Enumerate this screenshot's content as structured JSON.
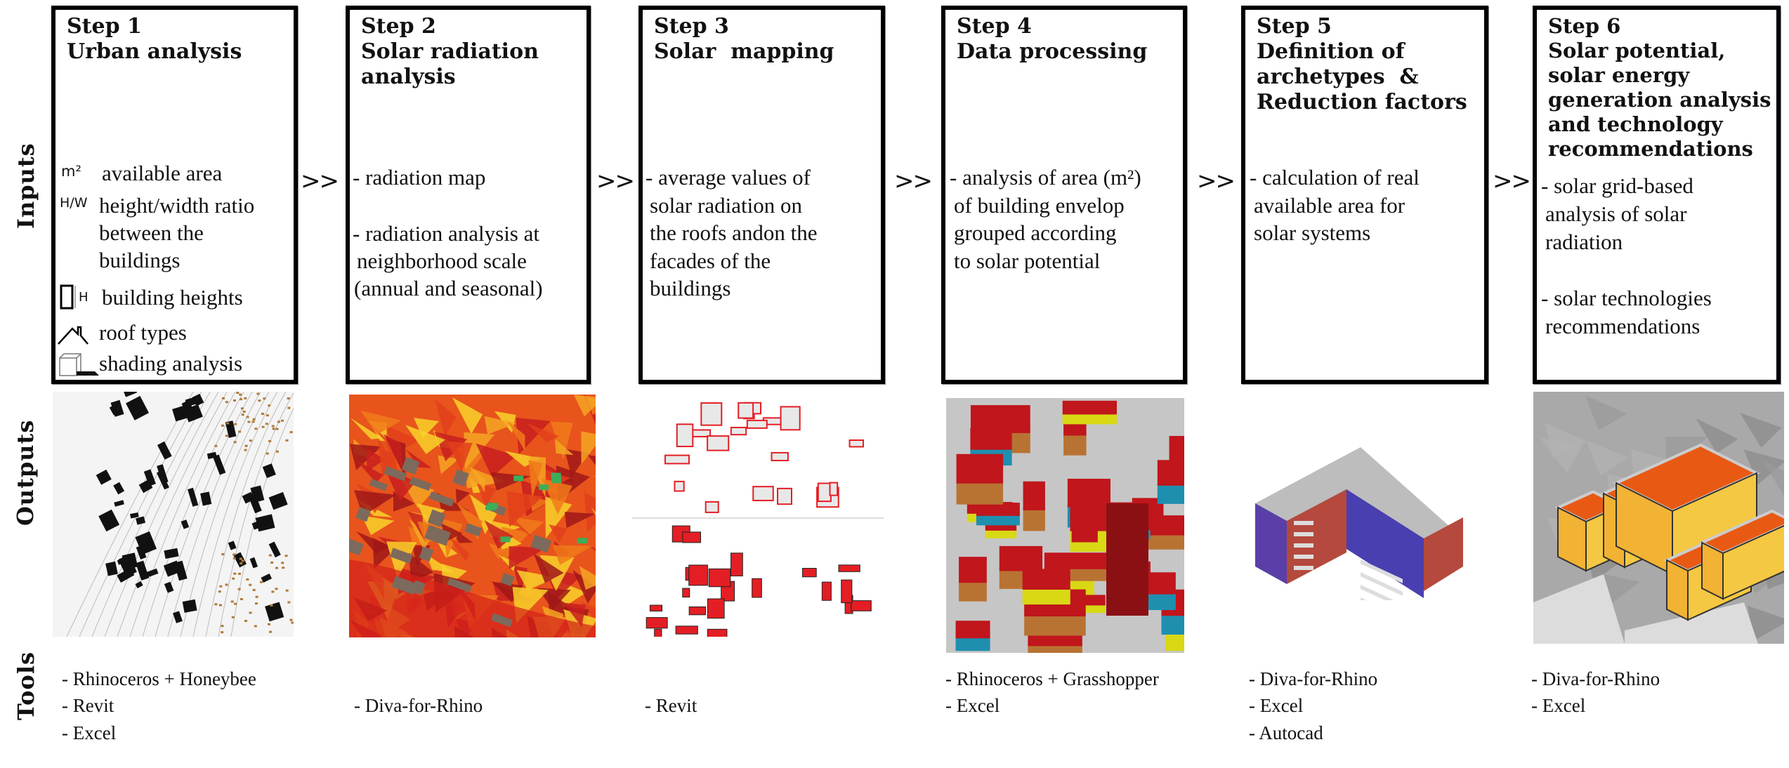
{
  "row_labels": {
    "inputs": "Inputs",
    "outputs": "Outputs",
    "tools": "Tools"
  },
  "separator": ">>",
  "steps": [
    {
      "number": "Step 1",
      "title_lines": [
        "Urban analysis"
      ],
      "inputs": [
        {
          "icon": "area-m2-icon",
          "icon_text": "m²",
          "lines": [
            "available area"
          ]
        },
        {
          "icon": "height-width-ratio-icon",
          "icon_text": "H/W",
          "lines": [
            "height/width ratio",
            "between the",
            "buildings"
          ]
        },
        {
          "icon": "building-height-icon",
          "icon_text": "H",
          "lines": [
            "building heights"
          ]
        },
        {
          "icon": "roof-icon",
          "icon_text": "",
          "lines": [
            "roof types"
          ]
        },
        {
          "icon": "shading-cube-icon",
          "icon_text": "",
          "lines": [
            "shading analysis"
          ]
        }
      ],
      "output_image": "urban-site-plan-map",
      "tools": [
        "- Rhinoceros + Honeybee",
        "- Revit",
        "- Excel"
      ]
    },
    {
      "number": "Step 2",
      "title_lines": [
        "Solar radiation",
        "analysis"
      ],
      "inputs": [
        "- radiation map",
        "",
        "- radiation analysis at",
        " neighborhood scale",
        "(annual and seasonal)"
      ],
      "output_image": "radiation-heatmap",
      "tools": [
        "",
        "- Diva-for-Rhino"
      ]
    },
    {
      "number": "Step 3",
      "title_lines": [
        "Solar  mapping"
      ],
      "inputs": [
        "- average values of",
        " solar radiation on",
        " the roofs andon the",
        " facades of the",
        " buildings"
      ],
      "output_image": "solar-mapping-plan",
      "tools": [
        "",
        "- Revit"
      ]
    },
    {
      "number": "Step 4",
      "title_lines": [
        "Data processing"
      ],
      "inputs": [
        "- analysis of area (m²)",
        " of building envelop",
        " grouped according",
        " to solar potential"
      ],
      "output_image": "3d-building-envelope-model",
      "tools": [
        "- Rhinoceros + Grasshopper",
        "- Excel"
      ]
    },
    {
      "number": "Step 5",
      "title_lines": [
        "Definition of",
        "archetypes  &",
        "Reduction factors"
      ],
      "inputs": [
        "- calculation of real",
        " available area for",
        " solar systems"
      ],
      "output_image": "building-archetype-model",
      "tools": [
        "- Diva-for-Rhino",
        "- Excel",
        "- Autocad"
      ]
    },
    {
      "number": "Step 6",
      "title_lines": [
        "Solar potential,",
        "solar energy",
        "generation analysis",
        "and technology",
        "recommendations"
      ],
      "inputs": [
        "- solar grid-based",
        " analysis of solar",
        " radiation",
        "",
        "- solar technologies",
        " recommendations"
      ],
      "output_image": "solar-potential-3d-model",
      "tools": [
        "- Diva-for-Rhino",
        "- Excel"
      ]
    }
  ],
  "colors": {
    "radiation_red": "#d7261e",
    "radiation_orange": "#f07a1a",
    "radiation_yellow": "#f8d22a",
    "building_red": "#e31e24",
    "facade_yellow": "#d8d815",
    "facade_blue": "#1f8fb0",
    "facade_brown": "#b87333",
    "ground_gray": "#c8c8c8",
    "panel_orange": "#e85a14"
  }
}
